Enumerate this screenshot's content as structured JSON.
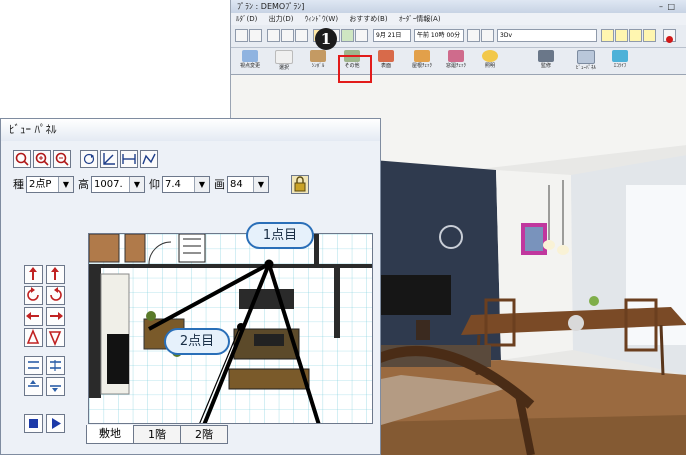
{
  "app": {
    "title": "ﾌﾟﾗﾝ : DEMOﾌﾟﾗﾝ]",
    "menu": [
      "ﾙﾀﾞ(D)",
      "出力(D)",
      "ｳｨﾝﾄﾞｳ(W)",
      "おすすめ(B)",
      "ｵｰﾀﾞｰ情報(A)"
    ],
    "toolbar_selects": {
      "month": "9月 21日",
      "time": "午前 10時 00分",
      "mode": "3Dv"
    },
    "big_buttons": [
      {
        "label": "視点変更",
        "icon": "move-icon"
      },
      {
        "label": "選択",
        "icon": "cursor-icon"
      },
      {
        "label": "ｼﾝﾎﾞﾙ",
        "icon": "symbol-icon"
      },
      {
        "label": "その他",
        "icon": "other-icon"
      },
      {
        "label": "表面",
        "icon": "surface-icon"
      },
      {
        "label": "屋根ﾁｪｯｸ",
        "icon": "roof-check-icon"
      },
      {
        "label": "窓廻ﾁｪｯｸ",
        "icon": "window-check-icon"
      },
      {
        "label": "照明",
        "icon": "light-icon"
      },
      {
        "label": "監修",
        "icon": "supervise-icon"
      },
      {
        "label": "ﾋﾞｭｰﾊﾟﾈﾙ",
        "icon": "view-panel-icon"
      },
      {
        "label": "ｴｺﾗｲﾌ",
        "icon": "eco-life-icon"
      }
    ],
    "step_marker": "1"
  },
  "panel": {
    "title": "ﾋﾞｭｰ ﾊﾟﾈﾙ",
    "row2": {
      "kind_label": "種",
      "kind_value": "2点P",
      "height_label": "高",
      "height_value": "1007.",
      "elev_label": "仰",
      "elev_value": "7.4",
      "view_label": "画",
      "view_value": "84"
    },
    "tabs": [
      "敷地",
      "1階",
      "2階"
    ],
    "callouts": {
      "point1": "1点目",
      "point2": "2点目"
    }
  }
}
